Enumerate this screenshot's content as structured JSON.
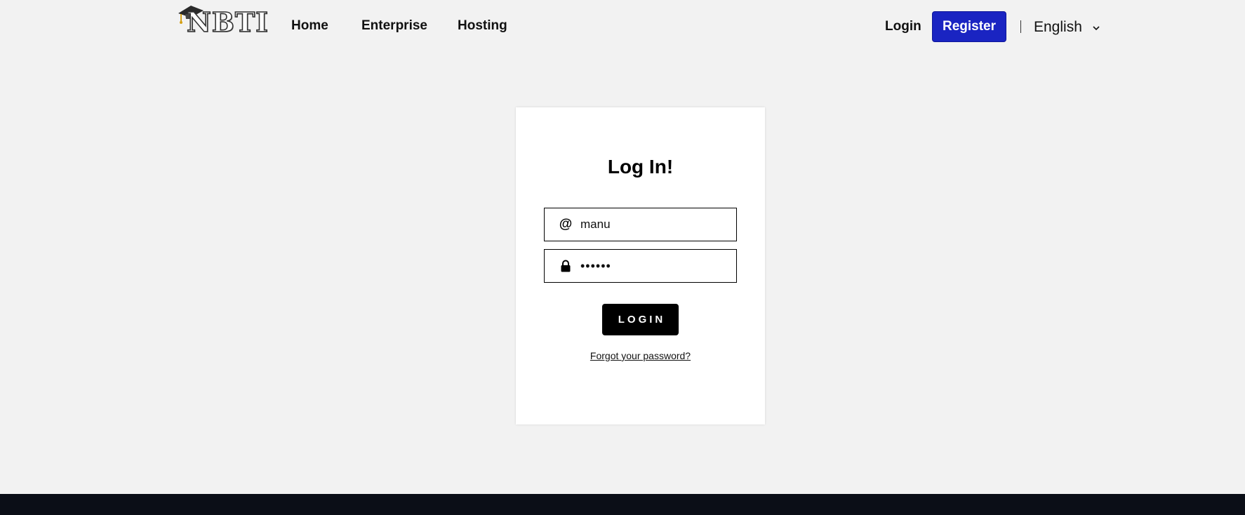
{
  "header": {
    "logo_text": "NBTI",
    "nav": {
      "home": "Home",
      "enterprise": "Enterprise",
      "hosting": "Hosting"
    },
    "login_label": "Login",
    "register_label": "Register",
    "language": "English"
  },
  "login_form": {
    "title": "Log In!",
    "username_icon": "at-icon",
    "username_value": "manu",
    "password_icon": "lock-icon",
    "password_value": "••••••",
    "submit_label": "LOGIN",
    "forgot_label": "Forgot your password?"
  },
  "colors": {
    "page_background": "#f2f2f2",
    "register_button": "#1a24c2",
    "login_button": "#000000",
    "footer": "#0b0e17"
  }
}
